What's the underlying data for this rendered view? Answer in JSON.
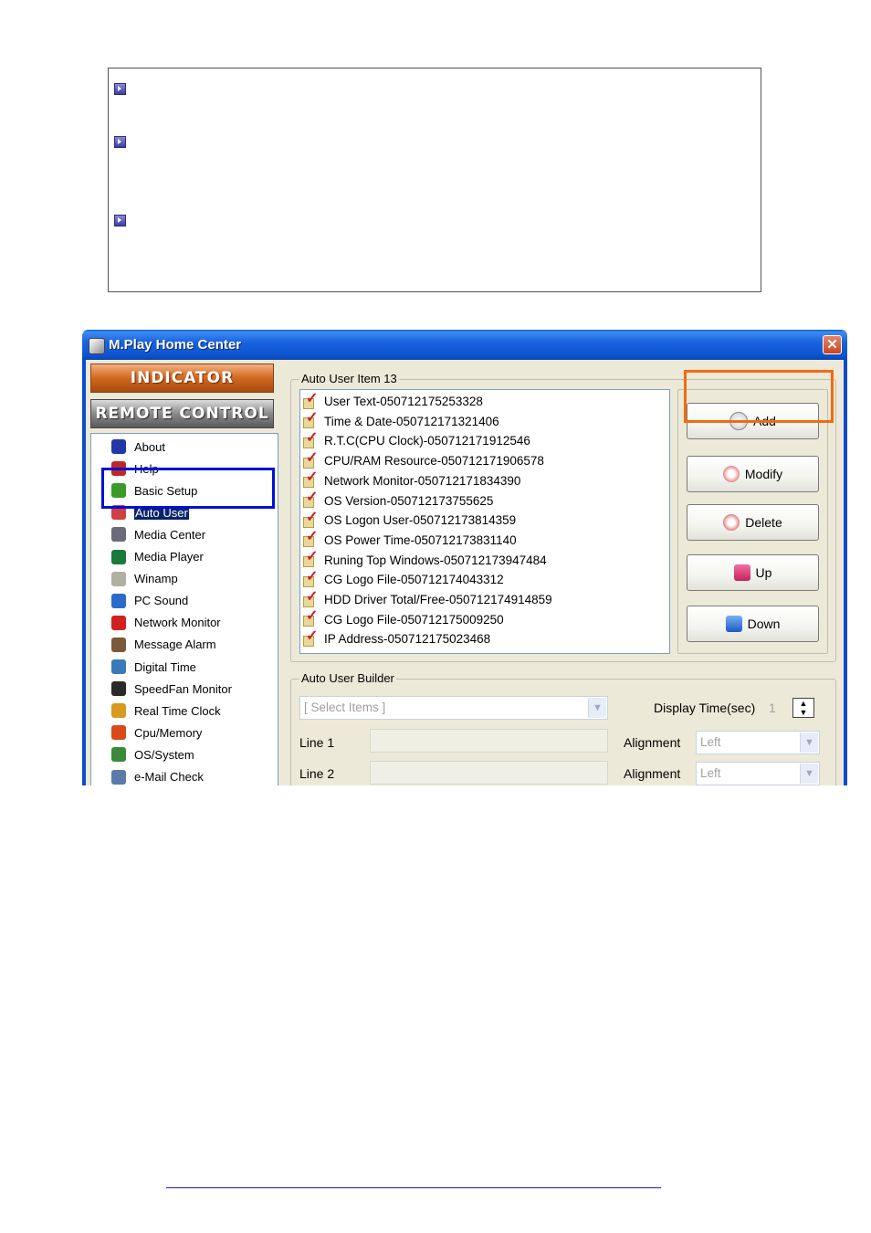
{
  "window": {
    "title": "M.Play Home Center",
    "close_label": "✕"
  },
  "nav": {
    "indicator_label": "INDICATOR",
    "remote_control_label": "REMOTE CONTROL",
    "items": [
      {
        "label": "About",
        "icon": "user-icon",
        "color": "#2238a8"
      },
      {
        "label": "Help",
        "icon": "help-icon",
        "color": "#c02828"
      },
      {
        "label": "Basic Setup",
        "icon": "setup-icon",
        "color": "#3a9a2a"
      },
      {
        "label": "Auto User",
        "icon": "auto-user-icon",
        "color": "#d04040"
      },
      {
        "label": "Media Center",
        "icon": "media-center-icon",
        "color": "#6a6a7a"
      },
      {
        "label": "Media Player",
        "icon": "media-player-icon",
        "color": "#1a7a3a"
      },
      {
        "label": "Winamp",
        "icon": "winamp-icon",
        "color": "#b0b0a0"
      },
      {
        "label": "PC Sound",
        "icon": "sound-icon",
        "color": "#2a6ac8"
      },
      {
        "label": "Network Monitor",
        "icon": "network-icon",
        "color": "#d02020"
      },
      {
        "label": "Message Alarm",
        "icon": "alarm-icon",
        "color": "#7a5a3a"
      },
      {
        "label": "Digital Time",
        "icon": "clock-icon",
        "color": "#3a7ab8"
      },
      {
        "label": "SpeedFan Monitor",
        "icon": "fan-icon",
        "color": "#2a2a2a"
      },
      {
        "label": "Real Time Clock",
        "icon": "rtc-icon",
        "color": "#d89a20"
      },
      {
        "label": "Cpu/Memory",
        "icon": "cpu-icon",
        "color": "#d84a1a"
      },
      {
        "label": "OS/System",
        "icon": "os-icon",
        "color": "#3a8a3a"
      },
      {
        "label": "e-Mail Check",
        "icon": "mail-icon",
        "color": "#5a7aa8"
      }
    ],
    "selected": "Auto User"
  },
  "auto_user_items": {
    "group_title": "Auto User Item 13",
    "items": [
      "User Text-050712175253328",
      "Time & Date-050712171321406",
      "R.T.C(CPU Clock)-050712171912546",
      "CPU/RAM Resource-050712171906578",
      "Network Monitor-050712171834390",
      "OS Version-050712173755625",
      "OS Logon User-050712173814359",
      "OS Power Time-050712173831140",
      "Runing Top Windows-050712173947484",
      "CG Logo File-050712174043312",
      "HDD Driver Total/Free-050712174914859",
      "CG Logo File-050712175009250",
      "IP Address-050712175023468"
    ]
  },
  "buttons": {
    "add": "Add",
    "modify": "Modify",
    "delete": "Delete",
    "up": "Up",
    "down": "Down"
  },
  "builder": {
    "group_title": "Auto User Builder",
    "select_placeholder": "[ Select Items ]",
    "display_time_label": "Display Time(sec)",
    "display_time_value": "1",
    "line1_label": "Line 1",
    "line2_label": "Line 2",
    "alignment_label": "Alignment",
    "alignment1_value": "Left",
    "alignment2_value": "Left"
  },
  "colors": {
    "highlight_blue": "#0010d8",
    "highlight_orange": "#f46a10"
  }
}
